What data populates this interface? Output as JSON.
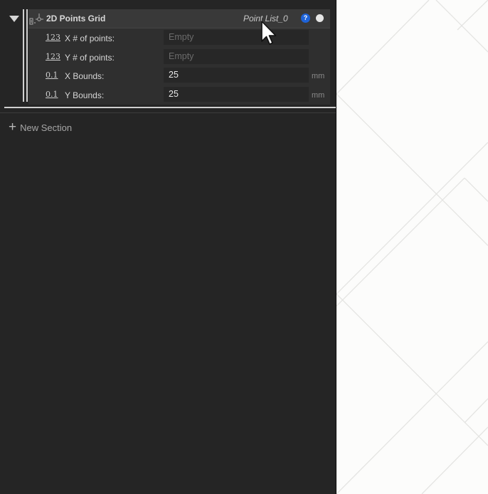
{
  "node": {
    "title": "2D Points Grid",
    "output_name": "Point List_0",
    "help_label": "?",
    "rows": [
      {
        "type_icon": "123",
        "label": "X # of points:",
        "placeholder": "Empty",
        "value": "",
        "unit": ""
      },
      {
        "type_icon": "123",
        "label": "Y # of points:",
        "placeholder": "Empty",
        "value": "",
        "unit": ""
      },
      {
        "type_icon": "0.1",
        "label": "X Bounds:",
        "placeholder": "",
        "value": "25",
        "unit": "mm"
      },
      {
        "type_icon": "0.1",
        "label": "Y Bounds:",
        "placeholder": "",
        "value": "25",
        "unit": "mm"
      }
    ]
  },
  "new_section": {
    "label": "New Section",
    "icon": "plus-icon"
  },
  "colors": {
    "panel": "#252525",
    "accent_help": "#1e63d8",
    "viewport": "#fcfcfb",
    "grid_line": "#e4e4e2"
  },
  "icons": {
    "collapse": "triangle-down-icon",
    "node_type": "points-grid-icon",
    "status": "status-dot-icon",
    "cursor": "mouse-pointer-icon"
  }
}
